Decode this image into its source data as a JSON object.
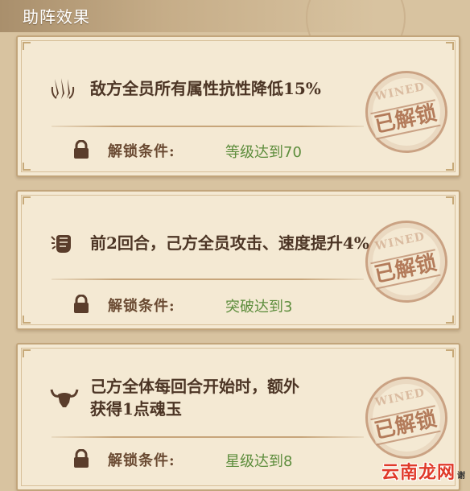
{
  "header": {
    "title": "助阵效果"
  },
  "cards": [
    {
      "effect": "敌方全员所有属性抗性降低15%",
      "effect_icon": "claw-mark-icon",
      "condition_label": "解锁条件:",
      "condition_value": "等级达到70",
      "stamp_en": "WINED",
      "stamp_cn": "已解锁"
    },
    {
      "effect": "前2回合，己方全员攻击、速度提升4%",
      "effect_icon": "fist-icon",
      "condition_label": "解锁条件:",
      "condition_value": "突破达到3",
      "stamp_en": "WINED",
      "stamp_cn": "已解锁"
    },
    {
      "effect_line1": "己方全体每回合开始时，额外",
      "effect_line2": "获得1点魂玉",
      "effect_icon": "horned-skull-icon",
      "condition_label": "解锁条件:",
      "condition_value": "星级达到8",
      "stamp_en": "WINED",
      "stamp_cn": "已解锁"
    }
  ],
  "watermark": {
    "text": "云南龙网",
    "small": "谢"
  },
  "colors": {
    "condition_value": "#5d8d3c",
    "effect_text": "#4c3525",
    "stamp": "#a05c38",
    "watermark": "#e03a2a"
  }
}
